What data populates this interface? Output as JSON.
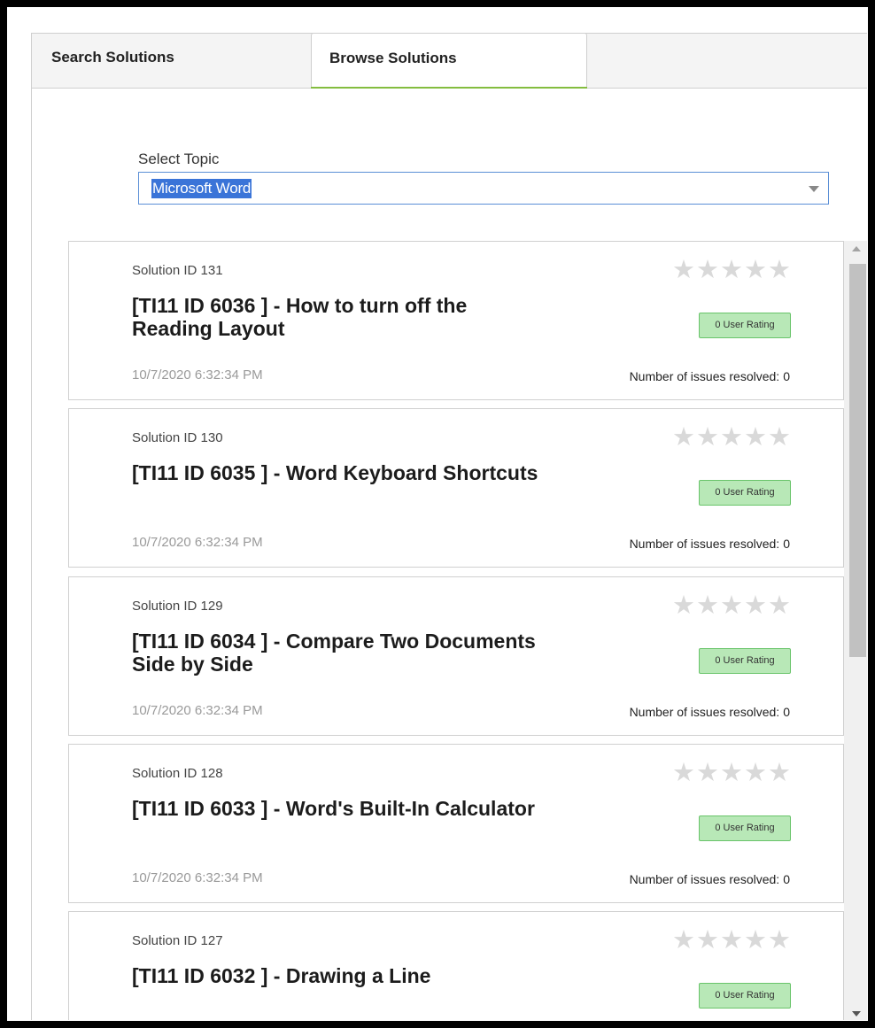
{
  "tabs": [
    {
      "label": "Search Solutions",
      "active": false
    },
    {
      "label": "Browse Solutions",
      "active": true
    }
  ],
  "topic": {
    "label": "Select Topic",
    "selected": "Microsoft Word"
  },
  "solutions": [
    {
      "id_label": "Solution ID 131",
      "title": "[TI11 ID 6036 ] - How to turn off the Reading Layout",
      "date": "10/7/2020 6:32:34 PM",
      "resolved_label": "Number of issues resolved:",
      "resolved_count": "0",
      "rating_badge": "0 User Rating",
      "stars": "★★★★★",
      "star_rating": 0
    },
    {
      "id_label": "Solution ID 130",
      "title": "[TI11 ID 6035 ] - Word Keyboard Shortcuts",
      "date": "10/7/2020 6:32:34 PM",
      "resolved_label": "Number of issues resolved:",
      "resolved_count": "0",
      "rating_badge": "0 User Rating",
      "stars": "★★★★★",
      "star_rating": 0
    },
    {
      "id_label": "Solution ID 129",
      "title": "[TI11 ID 6034 ] - Compare Two Documents Side by Side",
      "date": "10/7/2020 6:32:34 PM",
      "resolved_label": "Number of issues resolved:",
      "resolved_count": "0",
      "rating_badge": "0 User Rating",
      "stars": "★★★★★",
      "star_rating": 0
    },
    {
      "id_label": "Solution ID 128",
      "title": "[TI11 ID 6033 ] - Word's Built-In Calculator",
      "date": "10/7/2020 6:32:34 PM",
      "resolved_label": "Number of issues resolved:",
      "resolved_count": "0",
      "rating_badge": "0 User Rating",
      "stars": "★★★★★",
      "star_rating": 0
    },
    {
      "id_label": "Solution ID 127",
      "title": "[TI11 ID 6032 ] - Drawing a Line",
      "date": "",
      "resolved_label": "",
      "resolved_count": "",
      "rating_badge": "0 User Rating",
      "stars": "★★★★★",
      "star_rating": 0
    }
  ],
  "colors": {
    "tab_underline": "#84bd3f",
    "selection": "#3a74d8",
    "badge_bg": "#b8e8b7",
    "badge_border": "#69c46a",
    "star_empty": "#d9d9d9"
  }
}
